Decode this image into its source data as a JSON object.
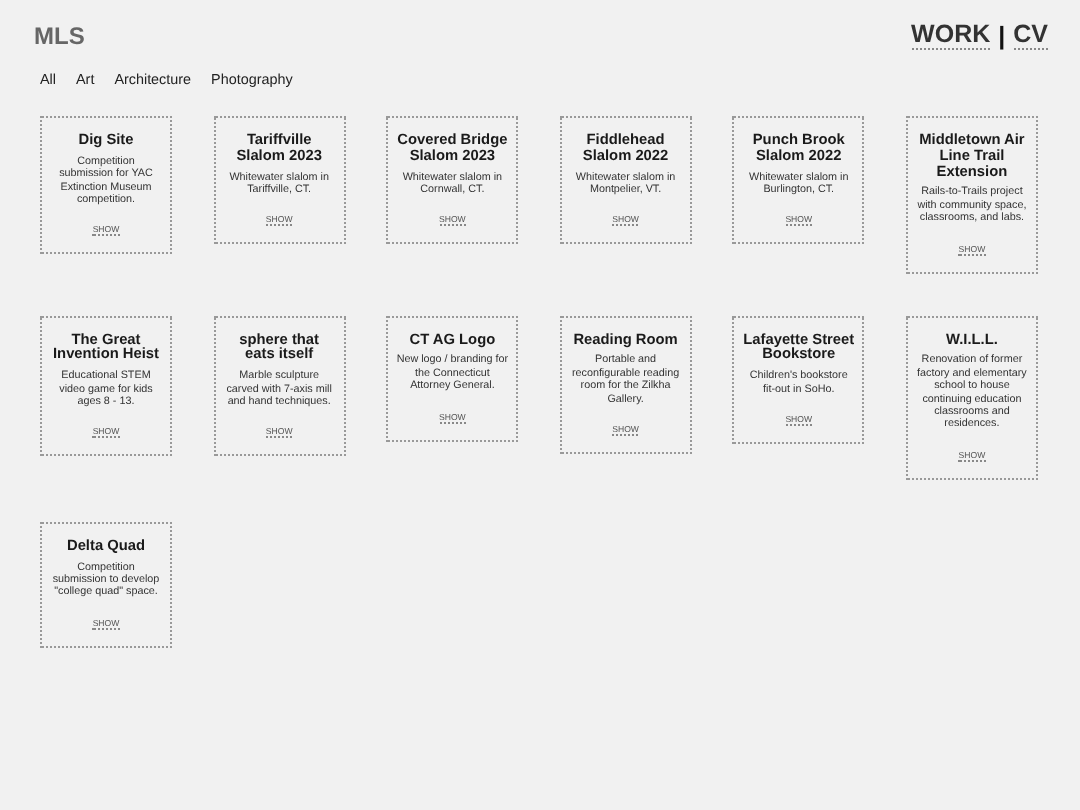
{
  "logo": "MLS",
  "nav": [
    "WORK",
    "CV"
  ],
  "nav_separator": "|",
  "filters": [
    "All",
    "Art",
    "Architecture",
    "Photography"
  ],
  "projects": [
    {
      "title": "Dig Site",
      "description": "Competition submission for YAC Extinction Museum competition.",
      "link": "SHOW"
    },
    {
      "title": "Tariffville Slalom 2023",
      "description": "Whitewater slalom in Tariffville, CT.",
      "link": "SHOW"
    },
    {
      "title": "Covered Bridge Slalom 2023",
      "description": "Whitewater slalom in Cornwall, CT.",
      "link": "SHOW"
    },
    {
      "title": "Fiddlehead Slalom 2022",
      "description": "Whitewater slalom in Montpelier, VT.",
      "link": "SHOW"
    },
    {
      "title": "Punch Brook Slalom 2022",
      "description": "Whitewater slalom in Burlington, CT.",
      "link": "SHOW"
    },
    {
      "title": "Middletown Air Line Trail Extension",
      "description": "Rails-to-Trails project with community space, classrooms, and labs.",
      "link": "SHOW"
    },
    {
      "title": "The Great Invention Heist",
      "description": "Educational STEM video game for kids ages 8 - 13.",
      "link": "SHOW"
    },
    {
      "title": "sphere that eats itself",
      "description": "Marble sculpture carved with 7-axis mill and hand techniques.",
      "link": "SHOW"
    },
    {
      "title": "CT AG Logo",
      "description": "New logo / branding for the Connecticut Attorney General.",
      "link": "SHOW"
    },
    {
      "title": "Reading Room",
      "description": "Portable and reconfigurable reading room for the Zilkha Gallery.",
      "link": "SHOW"
    },
    {
      "title": "Lafayette Street Bookstore",
      "description": "Children's bookstore fit-out in SoHo.",
      "link": "SHOW"
    },
    {
      "title": "W.I.L.L.",
      "description": "Renovation of former factory and elementary school to house continuing education classrooms and residences.",
      "link": "SHOW"
    },
    {
      "title": "Delta Quad",
      "description": "Competition submission to develop \"college quad\" space.",
      "link": "SHOW"
    }
  ]
}
